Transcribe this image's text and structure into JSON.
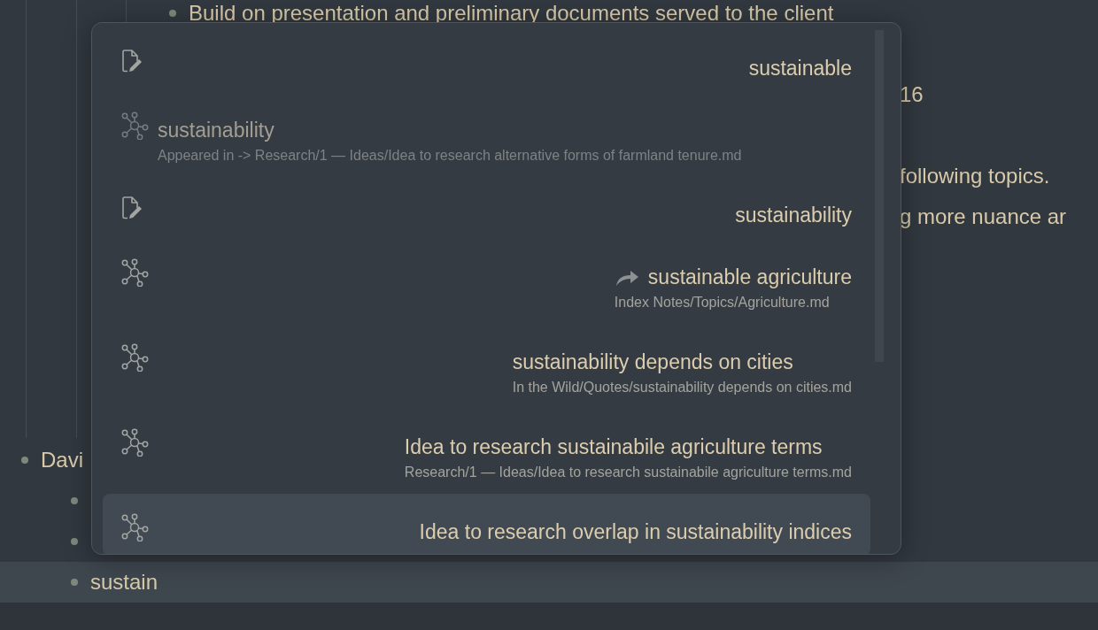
{
  "editor": {
    "lines": [
      {
        "kind": "bullet",
        "text": "Build on presentation and preliminary documents served to the client"
      },
      {
        "kind": "fragment",
        "text": "16"
      },
      {
        "kind": "fragment",
        "text": "following topics."
      },
      {
        "kind": "fragment",
        "text": "g more nuance ar"
      }
    ],
    "outline": [
      {
        "text": "Davi",
        "active": false,
        "children": [
          {
            "active": false
          },
          {
            "active": false
          },
          {
            "text": "sustain",
            "active": true
          }
        ]
      }
    ]
  },
  "suggestions": [
    {
      "kind": "file",
      "right_aligned": true,
      "dimmed": false,
      "selected": false,
      "title": "sustainable"
    },
    {
      "kind": "node",
      "right_aligned": false,
      "dimmed": true,
      "selected": false,
      "title": "sustainability",
      "subtitle": "Appeared in -> Research/1 — Ideas/Idea to research alternative forms of farmland tenure.md"
    },
    {
      "kind": "file",
      "right_aligned": true,
      "dimmed": false,
      "selected": false,
      "title": "sustainability"
    },
    {
      "kind": "node",
      "right_aligned": true,
      "dimmed": false,
      "selected": false,
      "redirect": true,
      "title": "sustainable agriculture",
      "subtitle": "Index Notes/Topics/Agriculture.md"
    },
    {
      "kind": "node",
      "right_aligned": true,
      "dimmed": false,
      "selected": false,
      "title": "sustainability depends on cities",
      "subtitle": "In the Wild/Quotes/sustainability depends on cities.md"
    },
    {
      "kind": "node",
      "right_aligned": true,
      "dimmed": false,
      "selected": false,
      "title": "Idea to research sustainabile agriculture terms",
      "subtitle": "Research/1 — Ideas/Idea to research sustainabile agriculture terms.md"
    },
    {
      "kind": "node",
      "right_aligned": true,
      "dimmed": false,
      "selected": true,
      "title": "Idea to research overlap in sustainability indices"
    }
  ]
}
